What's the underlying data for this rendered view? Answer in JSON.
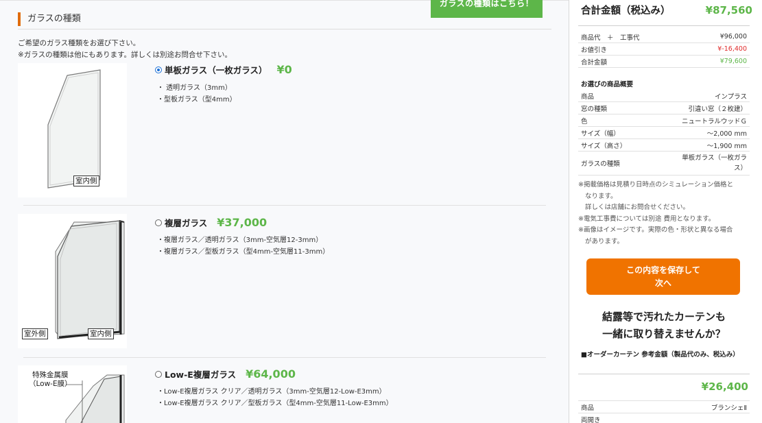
{
  "section": {
    "title": "ガラスの種類",
    "tab_label": "ガラスの種類はこちら！",
    "intro_lines": [
      "ご希望のガラス種類をお選び下さい。",
      "※ガラスの種類は他にもあります。詳しくは別途お問合せ下さい。"
    ]
  },
  "options": [
    {
      "name": "単板ガラス（一枚ガラス）",
      "price": "¥0",
      "selected": true,
      "specs": [
        "・ 透明ガラス（3mm）",
        "・型板ガラス（型4mm）"
      ],
      "image_labels": [
        "室内側"
      ]
    },
    {
      "name": "複層ガラス",
      "price": "¥37,000",
      "selected": false,
      "specs": [
        "・複層ガラス／透明ガラス（3mm-空気層12-3mm）",
        "・複層ガラス／型板ガラス（型4mm-空気層11-3mm）"
      ],
      "image_labels": [
        "室外側",
        "室内側"
      ]
    },
    {
      "name": "Low-E複層ガラス",
      "price": "¥64,000",
      "selected": false,
      "specs": [
        "・Low-E複層ガラス クリア／透明ガラス（3mm-空気層12-Low-E3mm）",
        "・Low-E複層ガラス クリア／型板ガラス（型4mm-空気層11-Low-E3mm）"
      ],
      "image_labels": [
        "特殊金属膜",
        "（Low-E膜）"
      ]
    }
  ],
  "sidebar": {
    "total_label": "合計金額（税込み）",
    "total_value": "¥87,560",
    "price_rows": [
      {
        "key": "商品代　＋　工事代",
        "value": "¥96,000",
        "color": "#333333"
      },
      {
        "key": "お値引き",
        "value": "¥-16,400",
        "color": "#e02b2b"
      },
      {
        "key": "合計金額",
        "value": "¥79,600",
        "color": "#5db649"
      }
    ],
    "summary_title": "お選びの商品概要",
    "summary_rows": [
      {
        "key": "商品",
        "value": "インプラス"
      },
      {
        "key": "窓の種類",
        "value": "引違い窓（２枚建）"
      },
      {
        "key": "色",
        "value": "ニュートラルウッドＧ"
      },
      {
        "key": "サイズ（幅）",
        "value": "～2,000 mm"
      },
      {
        "key": "サイズ（高さ）",
        "value": "～1,900 mm"
      },
      {
        "key": "ガラスの種類",
        "value_line1": "単板ガラス（一枚ガラ",
        "value_line2": "ス）"
      }
    ],
    "notes": [
      "※掲載価格は見積り日時点のシミュレーション価格と",
      "なります。",
      "詳しくは店舗にお問合せください。",
      "※電気工事費については別途 費用となります。",
      "※画像はイメージです。実際の色・形状と異なる場合",
      "があります。"
    ],
    "save_button_line1": "この内容を保存して",
    "save_button_line2": "次へ",
    "curtain_question_line1": "結露等で汚れたカーテンも",
    "curtain_question_line2": "一緒に取り替えませんか？",
    "curtain_note": "■オーダーカーテン 参考金額（製品代のみ、税込み）",
    "curtain_price": "¥26,400",
    "curtain_rows": [
      {
        "key": "商品",
        "value": "ブランシェⅡ"
      },
      {
        "key": "両開き",
        "value": ""
      }
    ]
  },
  "colors": {
    "accent_green": "#5db649",
    "accent_orange": "#f07300",
    "discount_red": "#e02b2b"
  }
}
